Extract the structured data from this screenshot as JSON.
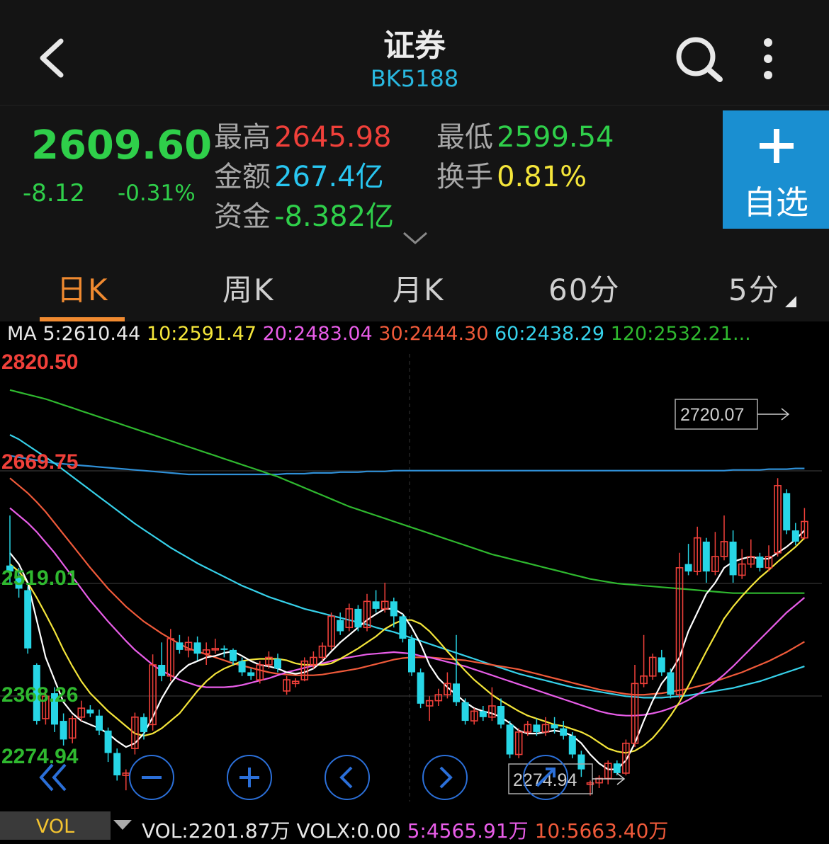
{
  "header": {
    "title": "证券",
    "code": "BK5188"
  },
  "quote": {
    "price": "2609.60",
    "change": "-8.12",
    "change_pct": "-0.31%",
    "high_label": "最高",
    "high": "2645.98",
    "low_label": "最低",
    "low": "2599.54",
    "amount_label": "金额",
    "amount": "267.4亿",
    "turnover_label": "换手",
    "turnover": "0.81%",
    "fund_label": "资金",
    "fund": "-8.382亿",
    "add_label": "自选"
  },
  "tabs": [
    {
      "label": "日K",
      "active": true
    },
    {
      "label": "周K"
    },
    {
      "label": "月K"
    },
    {
      "label": "60分"
    },
    {
      "label": "5分"
    }
  ],
  "ma": {
    "prefix": "MA",
    "ma5": "5:2610.44",
    "ma10": "10:2591.47",
    "ma20": "20:2483.04",
    "ma30": "30:2444.30",
    "ma60": "60:2438.29",
    "ma120": "120:2532.21..."
  },
  "chart_data": {
    "type": "candlestick",
    "y_axis_labels": [
      "2820.50",
      "2669.75",
      "2519.01",
      "2368.26",
      "2274.94"
    ],
    "ylim": [
      2274.94,
      2820.5
    ],
    "high_marker": "2720.07",
    "low_marker": "2274.94",
    "colors": {
      "up": "#f0403a",
      "down": "#27d6e6",
      "ma5": "#ffffff",
      "ma10": "#f4e53a",
      "ma20": "#e85de8",
      "ma30": "#f05a3a",
      "ma60": "#36d1ea",
      "ma120": "#2fb82f",
      "ma250": "#2f8fd6"
    },
    "candles": [
      [
        2543,
        2535,
        2610,
        2520
      ],
      [
        2528,
        2512,
        2540,
        2500
      ],
      [
        2510,
        2432,
        2515,
        2425
      ],
      [
        2410,
        2335,
        2412,
        2330
      ],
      [
        2338,
        2368,
        2375,
        2330
      ],
      [
        2372,
        2330,
        2380,
        2320
      ],
      [
        2335,
        2310,
        2345,
        2302
      ],
      [
        2312,
        2338,
        2342,
        2305
      ],
      [
        2340,
        2352,
        2362,
        2335
      ],
      [
        2350,
        2345,
        2356,
        2340
      ],
      [
        2342,
        2322,
        2350,
        2316
      ],
      [
        2322,
        2292,
        2326,
        2280
      ],
      [
        2292,
        2262,
        2298,
        2255
      ],
      [
        2262,
        2265,
        2270,
        2242
      ],
      [
        2298,
        2340,
        2346,
        2290
      ],
      [
        2340,
        2320,
        2345,
        2310
      ],
      [
        2330,
        2410,
        2424,
        2322
      ],
      [
        2410,
        2395,
        2440,
        2388
      ],
      [
        2395,
        2445,
        2458,
        2388
      ],
      [
        2440,
        2430,
        2450,
        2425
      ],
      [
        2430,
        2440,
        2448,
        2420
      ],
      [
        2440,
        2425,
        2448,
        2416
      ],
      [
        2425,
        2430,
        2440,
        2410
      ],
      [
        2430,
        2432,
        2445,
        2425
      ],
      [
        2432,
        2430,
        2436,
        2420
      ],
      [
        2430,
        2415,
        2432,
        2410
      ],
      [
        2415,
        2400,
        2420,
        2395
      ],
      [
        2400,
        2395,
        2405,
        2390
      ],
      [
        2390,
        2410,
        2415,
        2385
      ],
      [
        2410,
        2420,
        2428,
        2405
      ],
      [
        2418,
        2405,
        2425,
        2400
      ],
      [
        2375,
        2390,
        2395,
        2370
      ],
      [
        2385,
        2388,
        2392,
        2380
      ],
      [
        2390,
        2415,
        2420,
        2388
      ],
      [
        2410,
        2420,
        2428,
        2405
      ],
      [
        2420,
        2435,
        2440,
        2415
      ],
      [
        2435,
        2475,
        2480,
        2430
      ],
      [
        2470,
        2455,
        2480,
        2450
      ],
      [
        2460,
        2485,
        2492,
        2455
      ],
      [
        2485,
        2460,
        2490,
        2455
      ],
      [
        2460,
        2495,
        2505,
        2455
      ],
      [
        2495,
        2485,
        2510,
        2480
      ],
      [
        2485,
        2495,
        2520,
        2480
      ],
      [
        2495,
        2475,
        2500,
        2460
      ],
      [
        2475,
        2445,
        2478,
        2440
      ],
      [
        2445,
        2400,
        2450,
        2395
      ],
      [
        2400,
        2358,
        2405,
        2352
      ],
      [
        2355,
        2362,
        2368,
        2335
      ],
      [
        2362,
        2370,
        2378,
        2355
      ],
      [
        2370,
        2385,
        2400,
        2365
      ],
      [
        2385,
        2360,
        2450,
        2355
      ],
      [
        2360,
        2335,
        2365,
        2330
      ],
      [
        2335,
        2348,
        2352,
        2330
      ],
      [
        2348,
        2340,
        2355,
        2335
      ],
      [
        2340,
        2355,
        2380,
        2335
      ],
      [
        2355,
        2330,
        2365,
        2325
      ],
      [
        2330,
        2290,
        2335,
        2285
      ],
      [
        2290,
        2320,
        2325,
        2285
      ],
      [
        2320,
        2330,
        2335,
        2315
      ],
      [
        2330,
        2320,
        2338,
        2315
      ],
      [
        2320,
        2330,
        2340,
        2315
      ],
      [
        2330,
        2325,
        2340,
        2318
      ],
      [
        2325,
        2315,
        2335,
        2310
      ],
      [
        2315,
        2290,
        2320,
        2285
      ],
      [
        2290,
        2270,
        2295,
        2260
      ],
      [
        2250,
        2252,
        2255,
        2235
      ],
      [
        2252,
        2258,
        2262,
        2245
      ],
      [
        2258,
        2278,
        2282,
        2250
      ],
      [
        2278,
        2265,
        2282,
        2262
      ],
      [
        2265,
        2305,
        2310,
        2262
      ],
      [
        2305,
        2385,
        2410,
        2300
      ],
      [
        2385,
        2395,
        2450,
        2380
      ],
      [
        2395,
        2420,
        2425,
        2390
      ],
      [
        2420,
        2400,
        2430,
        2395
      ],
      [
        2400,
        2370,
        2405,
        2365
      ],
      [
        2370,
        2540,
        2560,
        2365
      ],
      [
        2545,
        2535,
        2572,
        2530
      ],
      [
        2535,
        2580,
        2595,
        2530
      ],
      [
        2575,
        2535,
        2580,
        2520
      ],
      [
        2535,
        2555,
        2588,
        2530
      ],
      [
        2555,
        2575,
        2610,
        2550
      ],
      [
        2575,
        2530,
        2590,
        2520
      ],
      [
        2530,
        2545,
        2565,
        2525
      ],
      [
        2545,
        2555,
        2578,
        2540
      ],
      [
        2555,
        2540,
        2560,
        2535
      ],
      [
        2540,
        2555,
        2570,
        2535
      ],
      [
        2560,
        2650,
        2660,
        2555
      ],
      [
        2640,
        2590,
        2645,
        2585
      ],
      [
        2590,
        2575,
        2600,
        2570
      ],
      [
        2580,
        2602,
        2620,
        2578
      ]
    ],
    "ma5": [
      2560,
      2545,
      2520,
      2470,
      2420,
      2390,
      2360,
      2345,
      2335,
      2330,
      2325,
      2318,
      2308,
      2300,
      2305,
      2318,
      2340,
      2365,
      2385,
      2400,
      2410,
      2415,
      2420,
      2422,
      2426,
      2428,
      2422,
      2415,
      2410,
      2408,
      2405,
      2400,
      2398,
      2400,
      2405,
      2415,
      2428,
      2440,
      2450,
      2460,
      2470,
      2478,
      2485,
      2485,
      2478,
      2460,
      2438,
      2410,
      2392,
      2380,
      2370,
      2360,
      2352,
      2348,
      2345,
      2340,
      2332,
      2322,
      2318,
      2318,
      2320,
      2322,
      2320,
      2315,
      2305,
      2290,
      2278,
      2270,
      2270,
      2282,
      2305,
      2335,
      2362,
      2385,
      2400,
      2420,
      2455,
      2480,
      2505,
      2520,
      2540,
      2548,
      2552,
      2555,
      2552,
      2552,
      2560,
      2568,
      2578,
      2590
    ],
    "ma10": [
      2545,
      2535,
      2520,
      2500,
      2478,
      2455,
      2430,
      2408,
      2388,
      2372,
      2360,
      2348,
      2338,
      2328,
      2318,
      2315,
      2318,
      2325,
      2335,
      2345,
      2360,
      2375,
      2388,
      2398,
      2405,
      2410,
      2415,
      2417,
      2418,
      2418,
      2418,
      2416,
      2412,
      2410,
      2410,
      2410,
      2412,
      2418,
      2425,
      2432,
      2440,
      2448,
      2458,
      2465,
      2470,
      2470,
      2465,
      2455,
      2442,
      2428,
      2415,
      2402,
      2390,
      2380,
      2370,
      2362,
      2355,
      2348,
      2342,
      2338,
      2334,
      2330,
      2328,
      2324,
      2320,
      2314,
      2306,
      2298,
      2294,
      2292,
      2295,
      2302,
      2312,
      2326,
      2342,
      2360,
      2382,
      2405,
      2428,
      2450,
      2472,
      2488,
      2502,
      2515,
      2527,
      2537,
      2548,
      2558,
      2568,
      2580
    ],
    "ma20": [
      2620,
      2610,
      2600,
      2588,
      2574,
      2560,
      2544,
      2528,
      2512,
      2496,
      2482,
      2468,
      2455,
      2442,
      2430,
      2420,
      2410,
      2402,
      2396,
      2390,
      2386,
      2382,
      2380,
      2380,
      2380,
      2381,
      2383,
      2386,
      2389,
      2392,
      2396,
      2400,
      2403,
      2406,
      2409,
      2412,
      2415,
      2418,
      2420,
      2422,
      2424,
      2425,
      2426,
      2427,
      2426,
      2425,
      2422,
      2420,
      2417,
      2414,
      2411,
      2408,
      2404,
      2400,
      2396,
      2392,
      2388,
      2384,
      2380,
      2376,
      2372,
      2368,
      2364,
      2360,
      2356,
      2352,
      2348,
      2345,
      2343,
      2342,
      2342,
      2343,
      2345,
      2348,
      2352,
      2357,
      2363,
      2370,
      2378,
      2387,
      2397,
      2408,
      2420,
      2432,
      2444,
      2456,
      2468,
      2480,
      2490,
      2500
    ],
    "ma30": [
      2660,
      2650,
      2640,
      2628,
      2615,
      2600,
      2585,
      2570,
      2555,
      2540,
      2526,
      2512,
      2500,
      2488,
      2478,
      2468,
      2460,
      2452,
      2445,
      2438,
      2432,
      2428,
      2424,
      2420,
      2416,
      2412,
      2409,
      2406,
      2403,
      2400,
      2398,
      2397,
      2396,
      2396,
      2396,
      2397,
      2399,
      2401,
      2403,
      2405,
      2408,
      2411,
      2414,
      2417,
      2419,
      2420,
      2420,
      2420,
      2419,
      2418,
      2417,
      2416,
      2414,
      2412,
      2410,
      2408,
      2406,
      2404,
      2401,
      2398,
      2395,
      2392,
      2389,
      2386,
      2383,
      2380,
      2377,
      2375,
      2373,
      2371,
      2370,
      2370,
      2371,
      2372,
      2374,
      2376,
      2378,
      2381,
      2384,
      2388,
      2392,
      2396,
      2400,
      2405,
      2410,
      2415,
      2421,
      2427,
      2434,
      2441
    ],
    "ma60": [
      2718,
      2712,
      2704,
      2696,
      2688,
      2680,
      2671,
      2662,
      2653,
      2644,
      2635,
      2626,
      2617,
      2608,
      2599,
      2591,
      2583,
      2575,
      2567,
      2560,
      2553,
      2546,
      2540,
      2534,
      2528,
      2522,
      2516,
      2511,
      2506,
      2501,
      2497,
      2493,
      2489,
      2485,
      2482,
      2479,
      2476,
      2473,
      2470,
      2467,
      2464,
      2460,
      2457,
      2454,
      2450,
      2446,
      2442,
      2438,
      2434,
      2430,
      2426,
      2422,
      2418,
      2414,
      2410,
      2406,
      2402,
      2398,
      2395,
      2392,
      2389,
      2386,
      2383,
      2380,
      2378,
      2376,
      2374,
      2372,
      2370,
      2368,
      2367,
      2366,
      2366,
      2366,
      2367,
      2368,
      2369,
      2371,
      2373,
      2375,
      2377,
      2379,
      2382,
      2385,
      2388,
      2392,
      2396,
      2400,
      2404,
      2408
    ],
    "ma120": [
      2778,
      2775,
      2772,
      2769,
      2766,
      2762,
      2758,
      2754,
      2750,
      2746,
      2742,
      2738,
      2734,
      2730,
      2726,
      2722,
      2718,
      2714,
      2710,
      2706,
      2702,
      2698,
      2694,
      2690,
      2686,
      2682,
      2678,
      2674,
      2670,
      2666,
      2662,
      2657,
      2652,
      2647,
      2642,
      2637,
      2632,
      2627,
      2622,
      2618,
      2614,
      2610,
      2606,
      2602,
      2598,
      2594,
      2590,
      2586,
      2582,
      2578,
      2574,
      2570,
      2566,
      2562,
      2558,
      2555,
      2552,
      2549,
      2546,
      2543,
      2540,
      2537,
      2534,
      2531,
      2528,
      2525,
      2523,
      2521,
      2519,
      2518,
      2517,
      2516,
      2515,
      2514,
      2513,
      2512,
      2511,
      2510,
      2509,
      2508,
      2507,
      2506,
      2506,
      2506,
      2506,
      2506,
      2506,
      2506,
      2506,
      2506
    ],
    "ma250": [
      2690,
      2688,
      2686,
      2684,
      2682,
      2680,
      2679,
      2678,
      2677,
      2676,
      2675,
      2674,
      2673,
      2672,
      2671,
      2670,
      2669,
      2668,
      2667,
      2666,
      2665,
      2665,
      2665,
      2665,
      2665,
      2665,
      2665,
      2665,
      2665,
      2665,
      2665,
      2666,
      2666,
      2666,
      2667,
      2667,
      2667,
      2668,
      2668,
      2668,
      2669,
      2669,
      2669,
      2670,
      2670,
      2670,
      2670,
      2670,
      2670,
      2670,
      2670,
      2670,
      2670,
      2670,
      2670,
      2670,
      2670,
      2670,
      2670,
      2670,
      2670,
      2670,
      2670,
      2670,
      2670,
      2670,
      2670,
      2670,
      2670,
      2670,
      2670,
      2670,
      2670,
      2670,
      2670,
      2670,
      2670,
      2670,
      2670,
      2670,
      2670,
      2671,
      2671,
      2671,
      2671,
      2672,
      2672,
      2672,
      2673,
      2673
    ]
  },
  "volume": {
    "tab_label": "VOL",
    "vol": "VOL:2201.87万",
    "volx": "VOLX:0.00",
    "ma5": "5:4565.91万",
    "ma10": "10:5663.40万"
  }
}
